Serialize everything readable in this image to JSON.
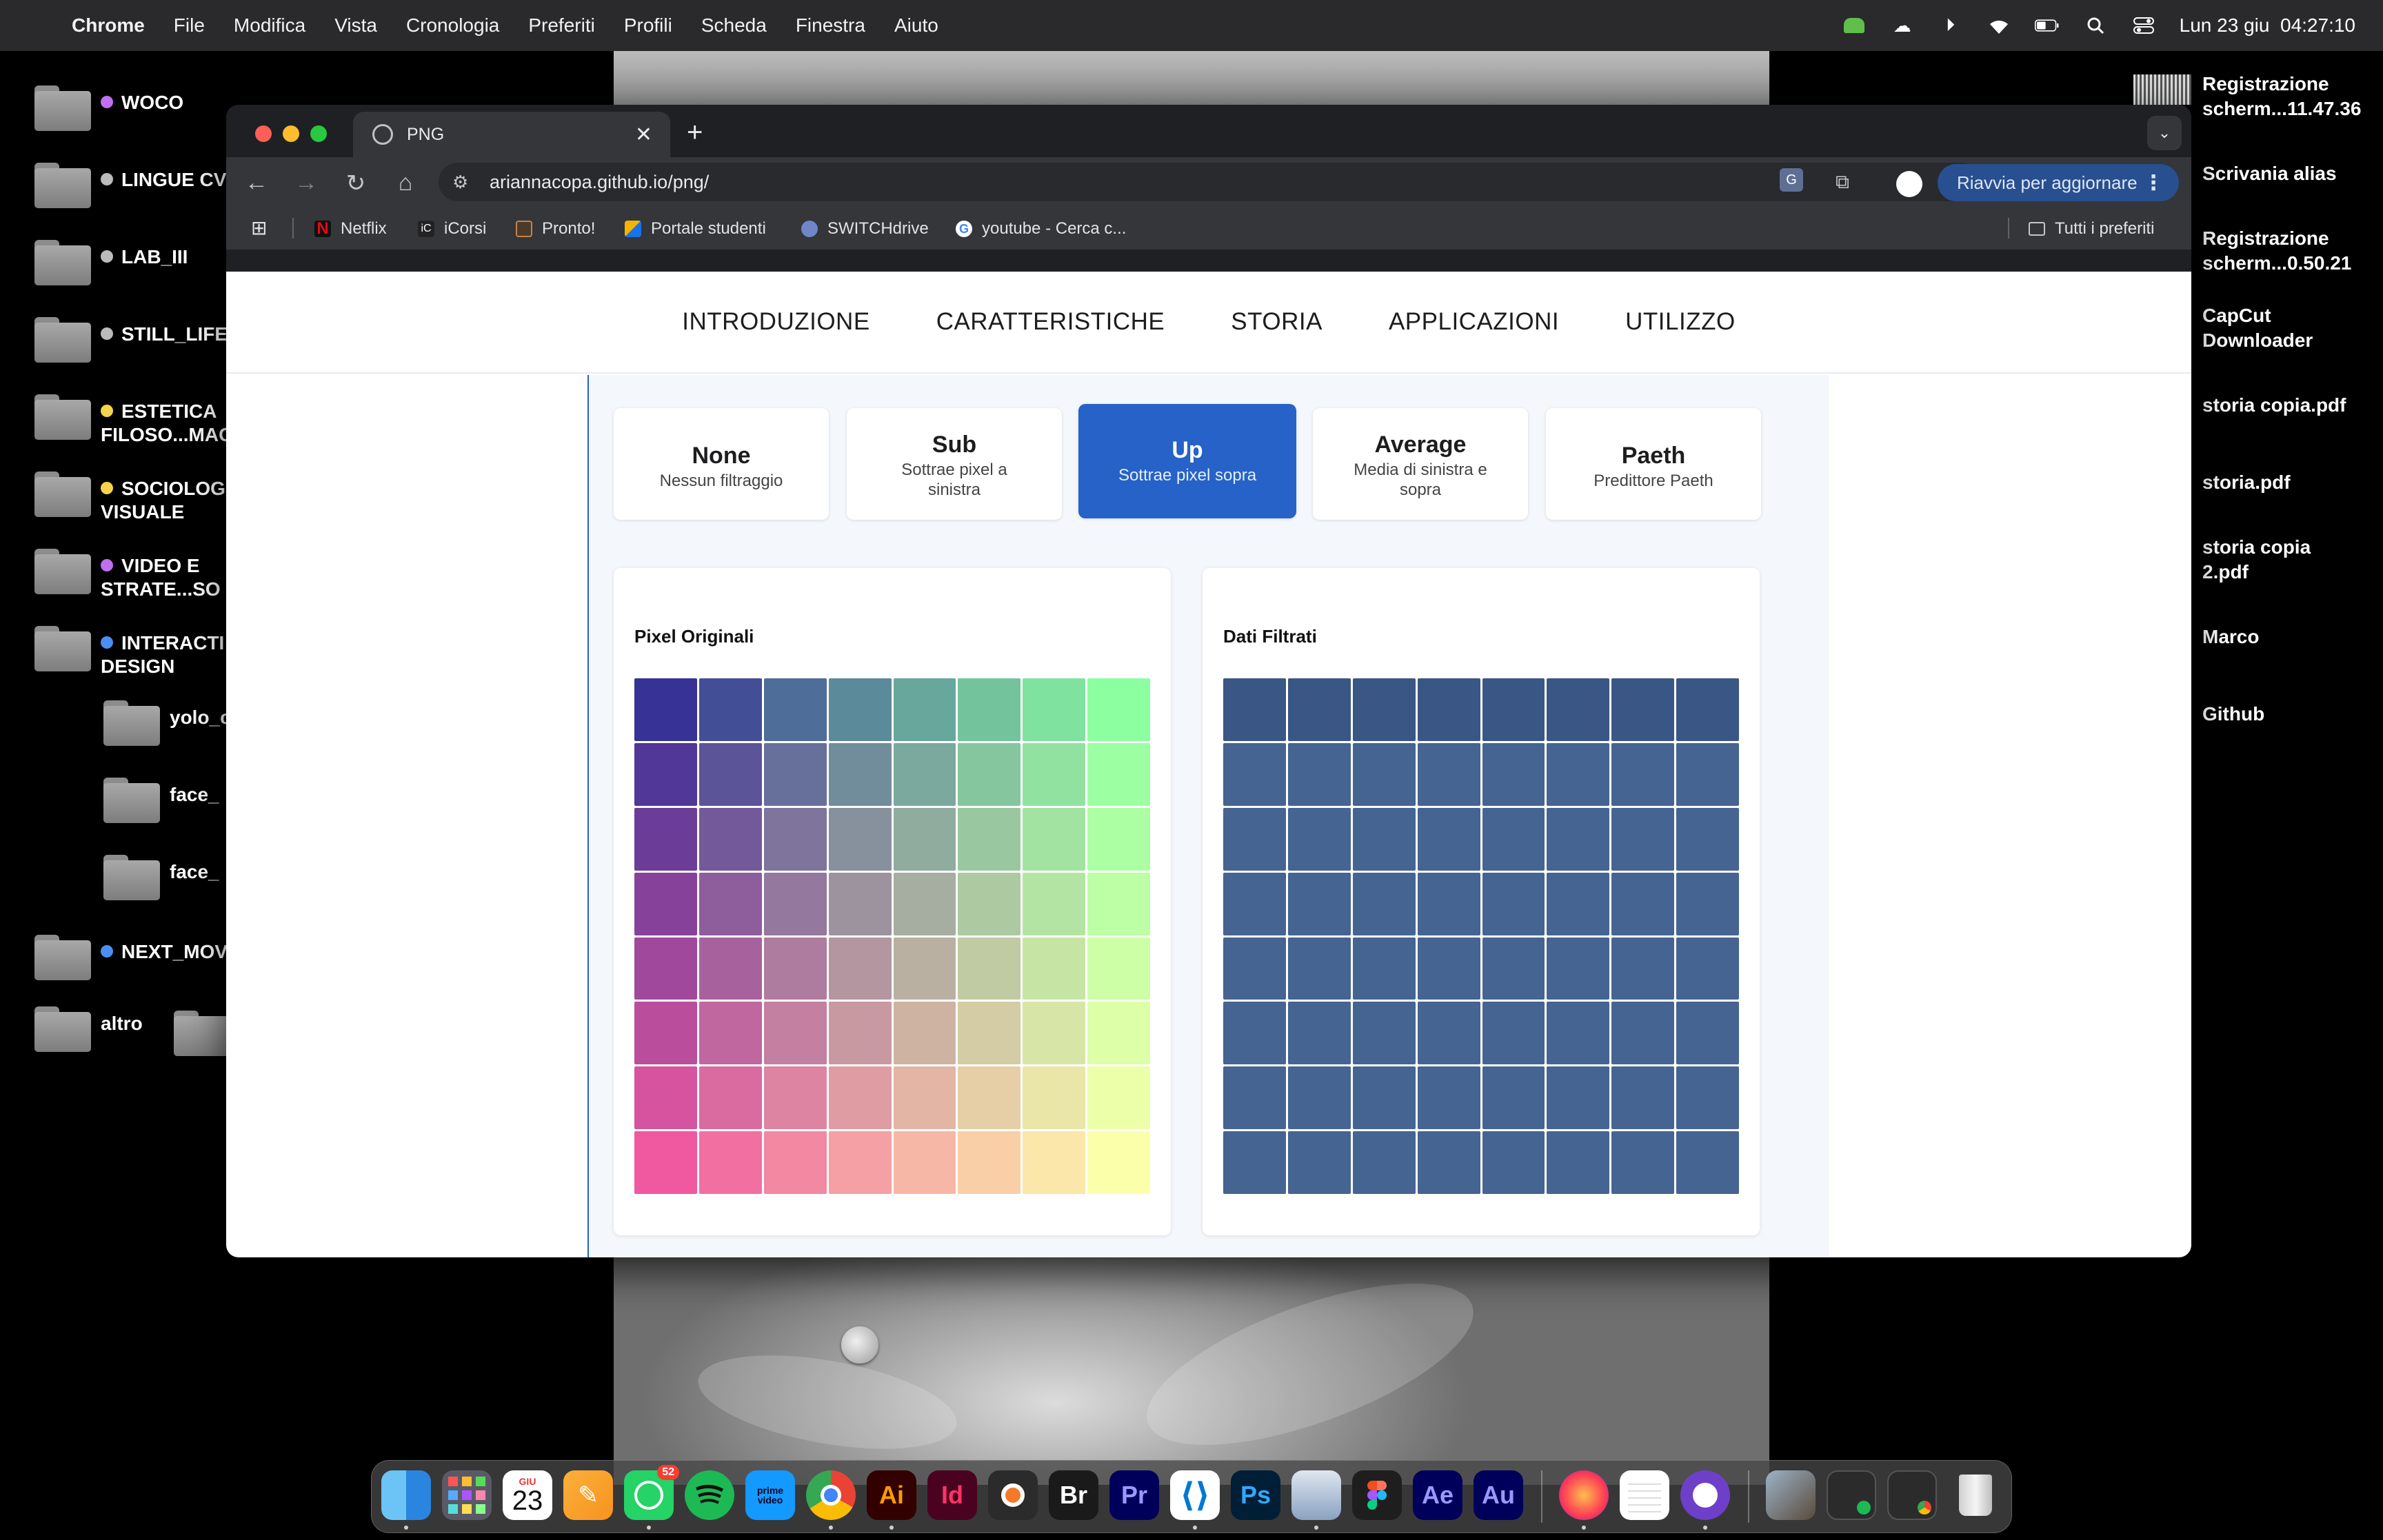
{
  "menubar": {
    "app": "Chrome",
    "items": [
      "File",
      "Modifica",
      "Vista",
      "Cronologia",
      "Preferiti",
      "Profili",
      "Scheda",
      "Finestra",
      "Aiuto"
    ],
    "clock": "Lun 23 giu  04:27:10"
  },
  "desktop": {
    "left_items": [
      {
        "label": "WOCO",
        "dot": "#c06ff0"
      },
      {
        "label": "LINGUE CV",
        "dot": "#bbbbbb"
      },
      {
        "label": "LAB_III",
        "dot": "#bbbbbb"
      },
      {
        "label": "STILL_LIFE",
        "dot": "#bbbbbb"
      },
      {
        "label": "ESTETICA",
        "label2": "FILOSO...MAG",
        "dot": "#f3d44a"
      },
      {
        "label": "SOCIOLOG",
        "label2": "VISUALE",
        "dot": "#f3d44a"
      },
      {
        "label": "VIDEO E",
        "label2": "STRATE...SO",
        "dot": "#c06ff0"
      },
      {
        "label": "INTERACTI",
        "label2": "DESIGN",
        "dot": "#4b8ef1"
      },
      {
        "label": "yolo_c"
      },
      {
        "label": "face_"
      },
      {
        "label": "face_"
      },
      {
        "label": "NEXT_MOV",
        "dot": "#4b8ef1"
      },
      {
        "label": "altro"
      }
    ],
    "right_items": [
      {
        "line1": "Registrazione",
        "line2": "scherm...11.47.36"
      },
      {
        "line1": "Scrivania alias",
        "line2": ""
      },
      {
        "line1": "Registrazione",
        "line2": "scherm...0.50.21"
      },
      {
        "line1": "CapCut",
        "line2": "Downloader"
      },
      {
        "line1": "storia copia.pdf",
        "line2": ""
      },
      {
        "line1": "storia.pdf",
        "line2": ""
      },
      {
        "line1": "storia copia",
        "line2": "2.pdf"
      },
      {
        "line1": "Marco",
        "line2": ""
      },
      {
        "line1": "Github",
        "line2": ""
      }
    ]
  },
  "browser": {
    "tab_title": "PNG",
    "url": "ariannacopa.github.io/png/",
    "update_label": "Riavvia per aggiornare",
    "bookmarks": [
      "Netflix",
      "iCorsi",
      "Pronto!",
      "Portale studenti",
      "SWITCHdrive",
      "youtube - Cerca c..."
    ],
    "all_bookmarks": "Tutti i preferiti"
  },
  "page": {
    "nav": [
      "INTRODUZIONE",
      "CARATTERISTICHE",
      "STORIA",
      "APPLICAZIONI",
      "UTILIZZO"
    ],
    "filters": [
      {
        "title": "None",
        "desc": "Nessun filtraggio"
      },
      {
        "title": "Sub",
        "desc": "Sottrae pixel a sinistra"
      },
      {
        "title": "Up",
        "desc": "Sottrae pixel sopra",
        "active": true
      },
      {
        "title": "Average",
        "desc": "Media di sinistra e sopra"
      },
      {
        "title": "Paeth",
        "desc": "Predittore Paeth"
      }
    ],
    "original_title": "Pixel Originali",
    "filtered_title": "Dati Filtrati",
    "filtered_color_first_row": "#3a5684",
    "filtered_color": "#466491"
  },
  "dock": {
    "calendar_month": "GIU",
    "calendar_day": "23",
    "whatsapp_badge": "52",
    "apps": [
      "finder-icon",
      "launchpad-icon",
      "calendar-icon",
      "pages-icon",
      "whatsapp-icon",
      "spotify-icon",
      "prime-video-icon",
      "chrome-icon",
      "illustrator-icon",
      "indesign-icon",
      "blender-icon",
      "bridge-icon",
      "premiere-icon",
      "vscode-icon",
      "photoshop-icon",
      "preview-icon",
      "figma-icon",
      "after-effects-icon",
      "audition-icon",
      "firefox-icon",
      "notes-icon",
      "github-desktop-icon"
    ],
    "labels": {
      "ai": "Ai",
      "id": "Id",
      "br": "Br",
      "pr": "Pr",
      "ps": "Ps",
      "ae": "Ae",
      "au": "Au",
      "prime": "prime video"
    }
  }
}
